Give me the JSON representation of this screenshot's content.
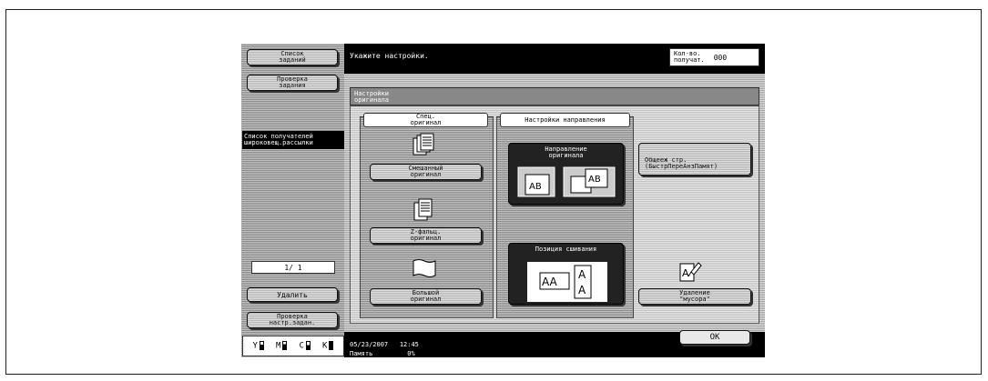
{
  "sidebar": {
    "job_list_btn": "Список\nзаданий",
    "job_check_btn": "Проверка\nзадания",
    "recipients_label": "Список получателей\nшироковещ.рассылки",
    "page_counter": "1/  1",
    "delete_btn": "Удалить",
    "check_settings_btn": "Проверка\nнастр.задан.",
    "toner": [
      "Y",
      "M",
      "C",
      "K"
    ]
  },
  "header": {
    "message": "Укажите настройки.",
    "recipients_count_label": "Кол-во.\nполучат.",
    "recipients_count_value": "000"
  },
  "main": {
    "title": "Настройки\nоригинала",
    "special_original_tab": "Спец.\nоригинал",
    "mixed_original_btn": "Смешанный\nоригинал",
    "z_fold_btn": "Z-фальц.\nоригинал",
    "long_original_btn": "Большой\nоригинал",
    "direction_tab": "Настройки направления",
    "original_direction_btn": "Направление\nоригинала",
    "binding_position_btn": "Позиция сшивания",
    "common_pages_btn": "Общееж стр.\n(БыстрПереАнзПамят)",
    "despeckle_btn": "Удаление\n\"мусора\""
  },
  "status": {
    "date": "05/23/2007",
    "time": "12:45",
    "memory_label": "Память",
    "memory_value": "0%"
  },
  "ok_btn": "OK",
  "colors": {
    "dark": "#000000",
    "stripe": "#a0a0a0"
  },
  "icons": [
    "mixed-original-icon",
    "z-fold-icon",
    "long-original-icon",
    "direction-icon",
    "binding-icon",
    "despeckle-icon"
  ]
}
